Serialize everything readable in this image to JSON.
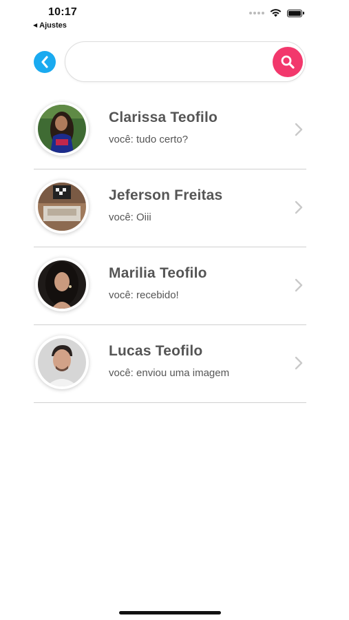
{
  "status_bar": {
    "time": "10:17",
    "back_app": "Ajustes"
  },
  "search": {
    "value": "",
    "placeholder": ""
  },
  "chats": [
    {
      "name": "Clarissa Teofilo",
      "preview": "você: tudo certo?"
    },
    {
      "name": "Jeferson Freitas",
      "preview": "você: Oiii"
    },
    {
      "name": "Marilia Teofilo",
      "preview": "você: recebido!"
    },
    {
      "name": "Lucas Teofilo",
      "preview": "você: enviou uma imagem"
    }
  ],
  "colors": {
    "back_button": "#1aaaf0",
    "search_button": "#f2386c",
    "text": "#555555",
    "divider": "#cfcfcf"
  },
  "icons": {
    "back": "chevron-left-icon",
    "search": "search-icon",
    "row_arrow": "chevron-right-icon",
    "wifi": "wifi-icon",
    "battery": "battery-icon"
  }
}
